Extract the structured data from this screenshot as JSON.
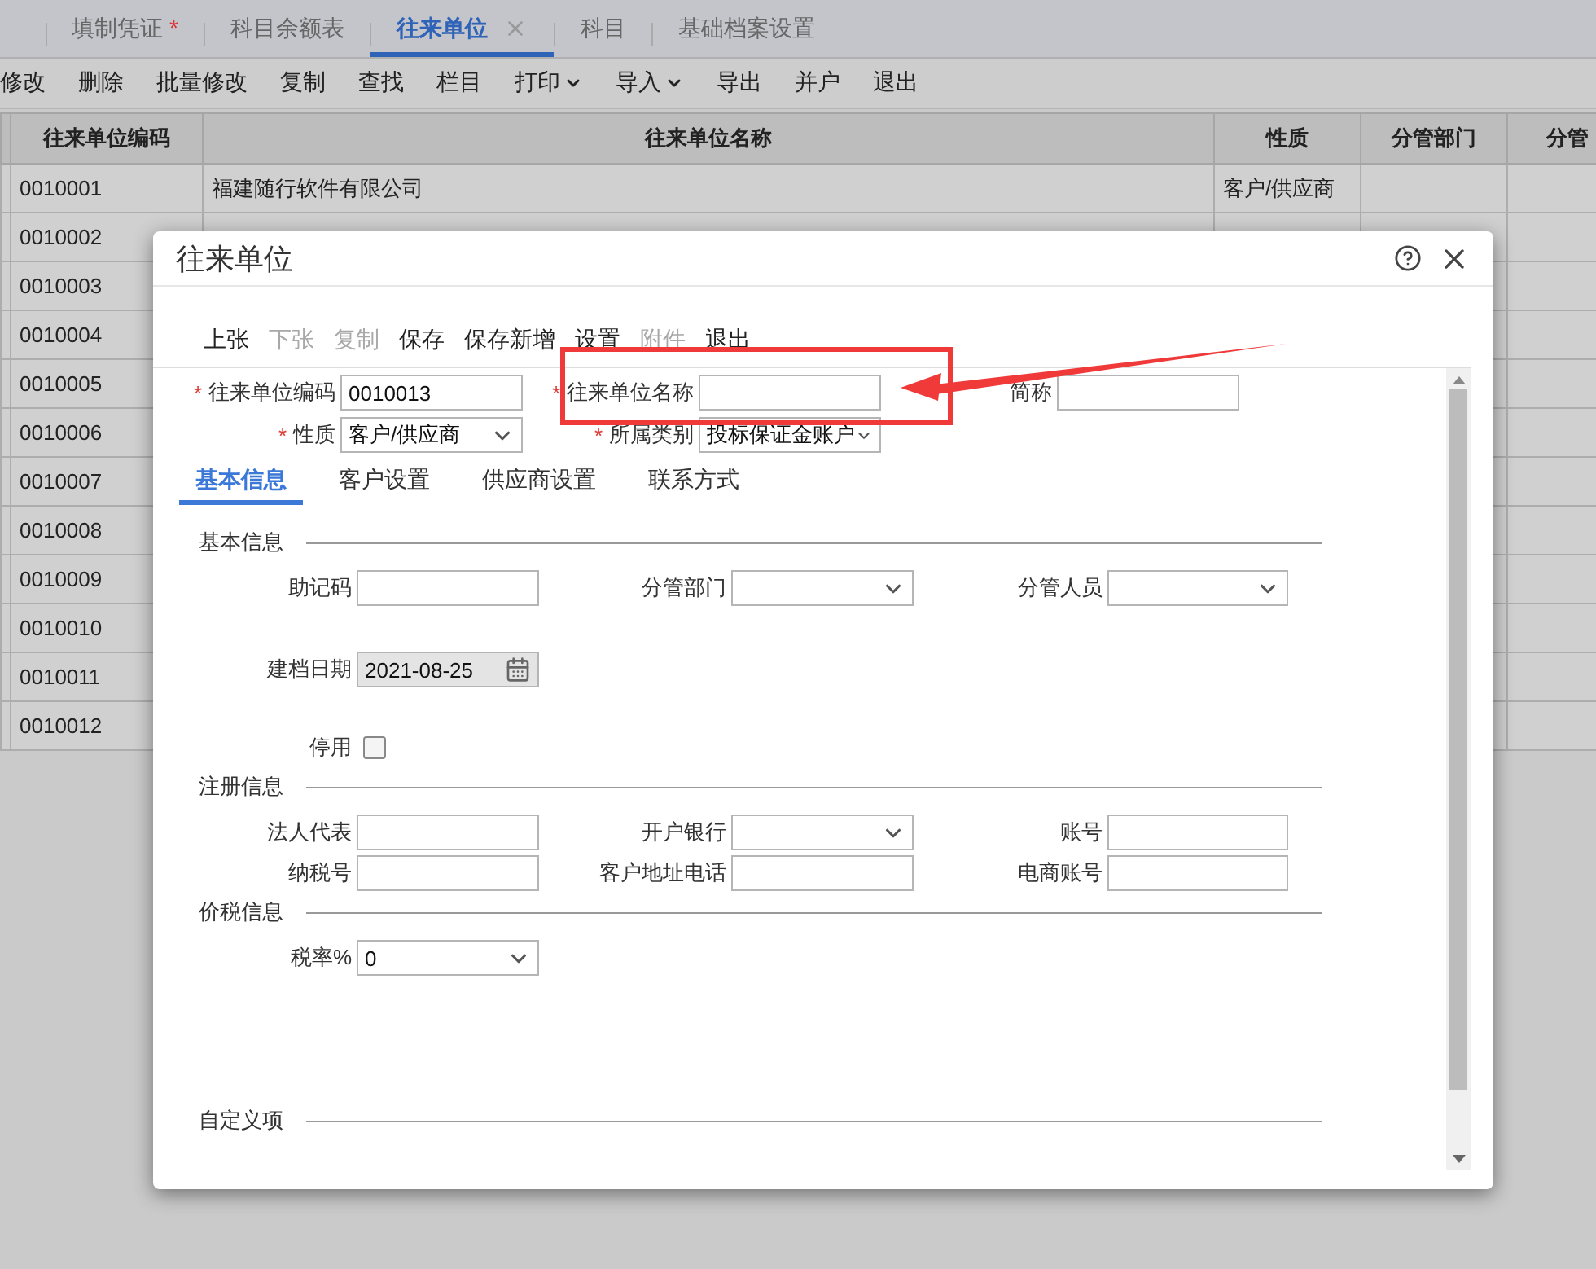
{
  "tabs": [
    {
      "label": "填制凭证",
      "badge": "*",
      "selected": false,
      "closable": false
    },
    {
      "label": "科目余额表",
      "selected": false,
      "closable": false
    },
    {
      "label": "往来单位",
      "selected": true,
      "closable": true
    },
    {
      "label": "科目",
      "selected": false,
      "closable": false
    },
    {
      "label": "基础档案设置",
      "selected": false,
      "closable": false
    }
  ],
  "toolbar": [
    {
      "label": "修改",
      "dropdown": false
    },
    {
      "label": "删除",
      "dropdown": false
    },
    {
      "label": "批量修改",
      "dropdown": false
    },
    {
      "label": "复制",
      "dropdown": false
    },
    {
      "label": "查找",
      "dropdown": false
    },
    {
      "label": "栏目",
      "dropdown": false
    },
    {
      "label": "打印",
      "dropdown": true
    },
    {
      "label": "导入",
      "dropdown": true
    },
    {
      "label": "导出",
      "dropdown": false
    },
    {
      "label": "并户",
      "dropdown": false
    },
    {
      "label": "退出",
      "dropdown": false
    }
  ],
  "table": {
    "columns": [
      "往来单位编码",
      "往来单位名称",
      "性质",
      "分管部门",
      "分管"
    ],
    "rows": [
      {
        "code": "0010001",
        "name": "福建随行软件有限公司",
        "nature": "客户/供应商"
      },
      {
        "code": "0010002"
      },
      {
        "code": "0010003"
      },
      {
        "code": "0010004"
      },
      {
        "code": "0010005"
      },
      {
        "code": "0010006"
      },
      {
        "code": "0010007"
      },
      {
        "code": "0010008"
      },
      {
        "code": "0010009"
      },
      {
        "code": "0010010"
      },
      {
        "code": "0010011"
      },
      {
        "code": "0010012"
      }
    ]
  },
  "dialog": {
    "title": "往来单位",
    "toolbar": [
      {
        "label": "上张",
        "disabled": false
      },
      {
        "label": "下张",
        "disabled": true
      },
      {
        "label": "复制",
        "disabled": true
      },
      {
        "label": "保存",
        "disabled": false
      },
      {
        "label": "保存新增",
        "disabled": false
      },
      {
        "label": "设置",
        "disabled": false
      },
      {
        "label": "附件",
        "disabled": true
      },
      {
        "label": "退出",
        "disabled": false
      }
    ],
    "header_fields": [
      {
        "label": "往来单位编码",
        "required": true,
        "kind": "text",
        "value": "0010013"
      },
      {
        "label": "往来单位名称",
        "required": true,
        "kind": "text"
      },
      {
        "label": "简称",
        "required": false,
        "kind": "text"
      },
      {
        "label": "性质",
        "required": true,
        "kind": "select",
        "value": "客户/供应商"
      },
      {
        "label": "所属类别",
        "required": true,
        "kind": "select",
        "value": "投标保证金账户"
      }
    ],
    "tabs": [
      {
        "label": "基本信息",
        "selected": true
      },
      {
        "label": "客户设置",
        "selected": false
      },
      {
        "label": "供应商设置",
        "selected": false
      },
      {
        "label": "联系方式",
        "selected": false
      }
    ],
    "sections": [
      {
        "title": "基本信息",
        "rows": [
          [
            {
              "label": "助记码",
              "kind": "text"
            },
            {
              "label": "分管部门",
              "kind": "select"
            },
            {
              "label": "分管人员",
              "kind": "select"
            }
          ],
          [
            {
              "label": "建档日期",
              "kind": "date",
              "value": "2021-08-25"
            }
          ],
          [
            {
              "label": "停用",
              "kind": "checkbox",
              "checked": false
            }
          ]
        ]
      },
      {
        "title": "注册信息",
        "rows": [
          [
            {
              "label": "法人代表",
              "kind": "text"
            },
            {
              "label": "开户银行",
              "kind": "select"
            },
            {
              "label": "账号",
              "kind": "text"
            }
          ],
          [
            {
              "label": "纳税号",
              "kind": "text"
            },
            {
              "label": "客户地址电话",
              "kind": "text"
            },
            {
              "label": "电商账号",
              "kind": "text"
            }
          ]
        ]
      },
      {
        "title": "价税信息",
        "rows": [
          [
            {
              "label": "税率%",
              "kind": "select",
              "value": "0"
            }
          ]
        ]
      },
      {
        "title": "自定义项"
      }
    ]
  }
}
